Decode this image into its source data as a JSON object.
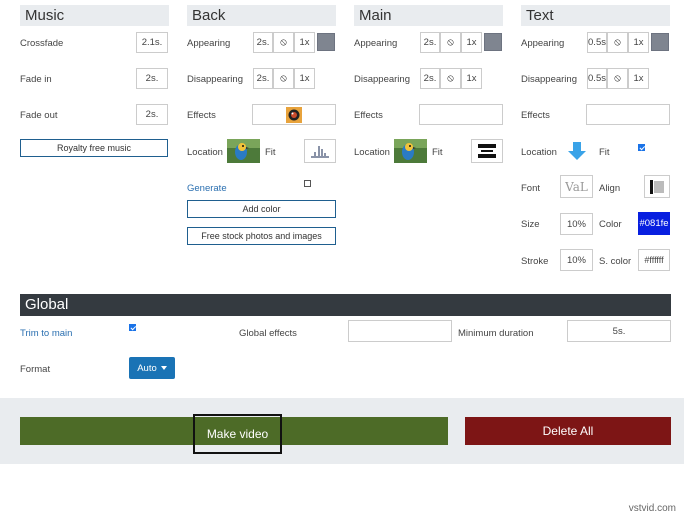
{
  "music": {
    "title": "Music",
    "crossfade_label": "Crossfade",
    "crossfade_value": "2.1s.",
    "fade_in_label": "Fade in",
    "fade_in_value": "2s.",
    "fade_out_label": "Fade out",
    "fade_out_value": "2s.",
    "royalty_button": "Royalty free music"
  },
  "back": {
    "title": "Back",
    "appearing_label": "Appearing",
    "appearing_time": "2s.",
    "appearing_speed": "1x",
    "disappearing_label": "Disappearing",
    "disappearing_time": "2s.",
    "disappearing_speed": "1x",
    "effects_label": "Effects",
    "location_label": "Location",
    "fit_label": "Fit",
    "generate_label": "Generate",
    "add_color_button": "Add color",
    "stock_photos_button": "Free stock photos and images"
  },
  "main": {
    "title": "Main",
    "appearing_label": "Appearing",
    "appearing_time": "2s.",
    "appearing_speed": "1x",
    "disappearing_label": "Disappearing",
    "disappearing_time": "2s.",
    "disappearing_speed": "1x",
    "effects_label": "Effects",
    "location_label": "Location",
    "fit_label": "Fit"
  },
  "text": {
    "title": "Text",
    "appearing_label": "Appearing",
    "appearing_time": "0.5s",
    "appearing_speed": "1x",
    "disappearing_label": "Disappearing",
    "disappearing_time": "0.5s",
    "disappearing_speed": "1x",
    "effects_label": "Effects",
    "location_label": "Location",
    "fit_label": "Fit",
    "font_label": "Font",
    "font_preview": "VaL",
    "align_label": "Align",
    "size_label": "Size",
    "size_value": "10%",
    "color_label": "Color",
    "color_value": "#081fe",
    "stroke_label": "Stroke",
    "stroke_value": "10%",
    "s_color_label": "S. color",
    "s_color_value": "#ffffff"
  },
  "global": {
    "title": "Global",
    "trim_label": "Trim to main",
    "effects_label": "Global effects",
    "min_duration_label": "Minimum duration",
    "min_duration_value": "5s.",
    "format_label": "Format",
    "format_value": "Auto"
  },
  "actions": {
    "make_video": "Make video",
    "delete_all": "Delete All"
  },
  "watermark": "vstvid.com",
  "colors": {
    "swatch": "#7f8590",
    "text_color": "#081fe0",
    "dark_header": "#343a40",
    "primary": "#1a73b5",
    "make_video_bg": "#4d6b27",
    "delete_bg": "#7d1515",
    "panel_bg": "#e9ecef"
  },
  "icons": [
    "ban-icon",
    "arrow-down-icon",
    "align-icon",
    "chevron-down-icon"
  ]
}
